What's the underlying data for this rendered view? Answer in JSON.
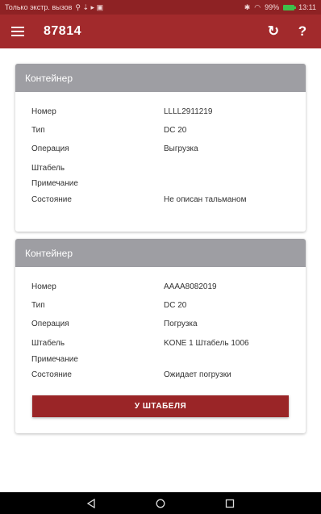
{
  "statusbar": {
    "carrier": "Только экстр. вызов",
    "battery": "99%",
    "time": "13:11"
  },
  "appbar": {
    "title": "87814",
    "refresh_icon": "↻",
    "help_icon": "?"
  },
  "cards": [
    {
      "header": "Контейнер",
      "rows": [
        {
          "label": "Номер",
          "value": "LLLL2911219"
        },
        {
          "label": "Тип",
          "value": "DC 20"
        },
        {
          "label": "Операция",
          "value": "Выгрузка"
        },
        {
          "label": "Штабель",
          "value": ""
        },
        {
          "label": "Примечание",
          "value": ""
        },
        {
          "label": "Состояние",
          "value": "Не описан тальманом"
        }
      ]
    },
    {
      "header": "Контейнер",
      "rows": [
        {
          "label": "Номер",
          "value": "AAAA8082019"
        },
        {
          "label": "Тип",
          "value": "DC 20"
        },
        {
          "label": "Операция",
          "value": "Погрузка"
        },
        {
          "label": "Штабель",
          "value": "KONE 1 Штабель 1006"
        },
        {
          "label": "Примечание",
          "value": ""
        },
        {
          "label": "Состояние",
          "value": "Ожидает погрузки"
        }
      ],
      "button": "У ШТАБЕЛЯ"
    }
  ],
  "colors": {
    "statusbar": "#8e2224",
    "appbar": "#a22a2c",
    "card_header": "#9e9ea3",
    "button": "#9a2527"
  }
}
